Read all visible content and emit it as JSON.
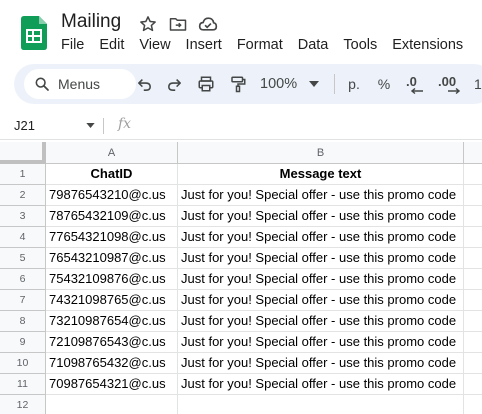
{
  "doc": {
    "title": "Mailing"
  },
  "menu": [
    "File",
    "Edit",
    "View",
    "Insert",
    "Format",
    "Data",
    "Tools",
    "Extensions"
  ],
  "toolbar": {
    "search_label": "Menus",
    "zoom": "100%",
    "currency_label": "p.",
    "percent_label": "%",
    "decrease_decimal_label": ".0",
    "increase_decimal_label": ".00",
    "more_formats_label": "12"
  },
  "formula_bar": {
    "cell_ref": "J21",
    "fx_label": "fx"
  },
  "sheet": {
    "columns": [
      "A",
      "B"
    ],
    "header": {
      "chat_id": "ChatID",
      "message": "Message text"
    },
    "rows": [
      {
        "num": "1"
      },
      {
        "num": "2",
        "a": "79876543210@c.us",
        "b": "Just for you! Special offer - use this promo code"
      },
      {
        "num": "3",
        "a": "78765432109@c.us",
        "b": "Just for you! Special offer - use this promo code"
      },
      {
        "num": "4",
        "a": "77654321098@c.us",
        "b": "Just for you! Special offer - use this promo code"
      },
      {
        "num": "5",
        "a": "76543210987@c.us",
        "b": "Just for you! Special offer - use this promo code"
      },
      {
        "num": "6",
        "a": "75432109876@c.us",
        "b": "Just for you! Special offer - use this promo code"
      },
      {
        "num": "7",
        "a": "74321098765@c.us",
        "b": "Just for you! Special offer - use this promo code"
      },
      {
        "num": "8",
        "a": "73210987654@c.us",
        "b": "Just for you! Special offer - use this promo code"
      },
      {
        "num": "9",
        "a": "72109876543@c.us",
        "b": "Just for you! Special offer - use this promo code"
      },
      {
        "num": "10",
        "a": "71098765432@c.us",
        "b": "Just for you! Special offer - use this promo code"
      },
      {
        "num": "11",
        "a": "70987654321@c.us",
        "b": "Just for you! Special offer - use this promo code"
      },
      {
        "num": "12"
      }
    ]
  },
  "colors": {
    "brand_green": "#0f9d58",
    "toolbar_bg": "#edf2fa",
    "header_bg": "#f8f9fa"
  },
  "icons": [
    "sheets-logo-icon",
    "star-icon",
    "move-folder-icon",
    "cloud-status-icon",
    "search-icon",
    "undo-icon",
    "redo-icon",
    "print-icon",
    "paint-format-icon",
    "chevron-down-icon"
  ]
}
